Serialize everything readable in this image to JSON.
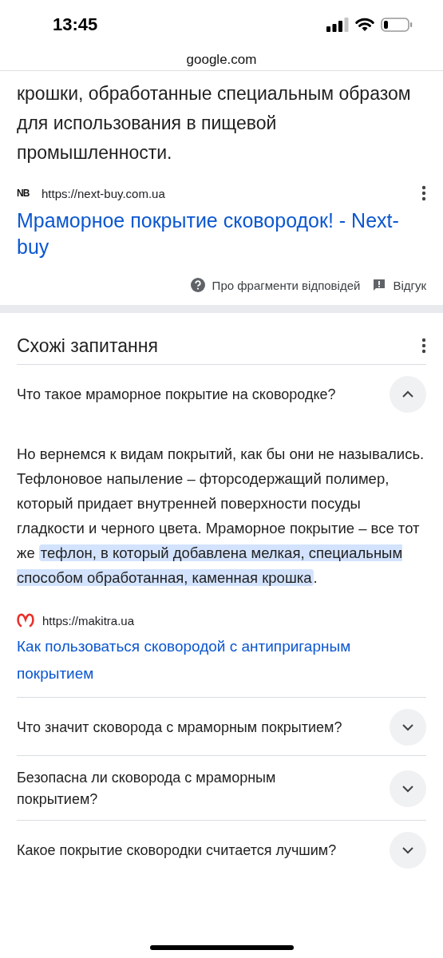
{
  "status_bar": {
    "time": "13:45"
  },
  "address_bar": {
    "domain": "google.com"
  },
  "snippet": {
    "text": "крошки, обработанные специальным образом для использования в пищевой промышленности.",
    "source": {
      "favicon_text": "NB",
      "url": "https://next-buy.com.ua"
    },
    "title": "Мраморное покрытие сковородок! - Next-buy",
    "footer": [
      {
        "kind": "about",
        "label": "Про фрагменти відповідей"
      },
      {
        "kind": "feedback",
        "label": "Відгук"
      }
    ]
  },
  "related_questions": {
    "title": "Схожі запитання",
    "items": [
      {
        "question": "Что такое мраморное покрытие на сковородке?",
        "expanded": true,
        "answer": {
          "text": "Но вернемся к видам покрытий, как бы они не назывались. Тефлоновое напыление – фторсодержащий полимер, который придает внутренней поверхности посуды гладкости и черного цвета. Мраморное покрытие – все тот же",
          "highlight": "тефлон, в который добавлена мелкая, специальным способом обработанная, каменная крошка",
          "after": "."
        },
        "source": {
          "url": "https://makitra.ua",
          "link": "Как пользоваться сковородой с антипригарным покрытием"
        }
      },
      {
        "question": "Что значит сковорода с мраморным покрытием?",
        "expanded": false
      },
      {
        "question": "Безопасна ли сковорода с мраморным покрытием?",
        "expanded": false
      },
      {
        "question": "Какое покрытие сковородки считается лучшим?",
        "expanded": false
      }
    ]
  }
}
